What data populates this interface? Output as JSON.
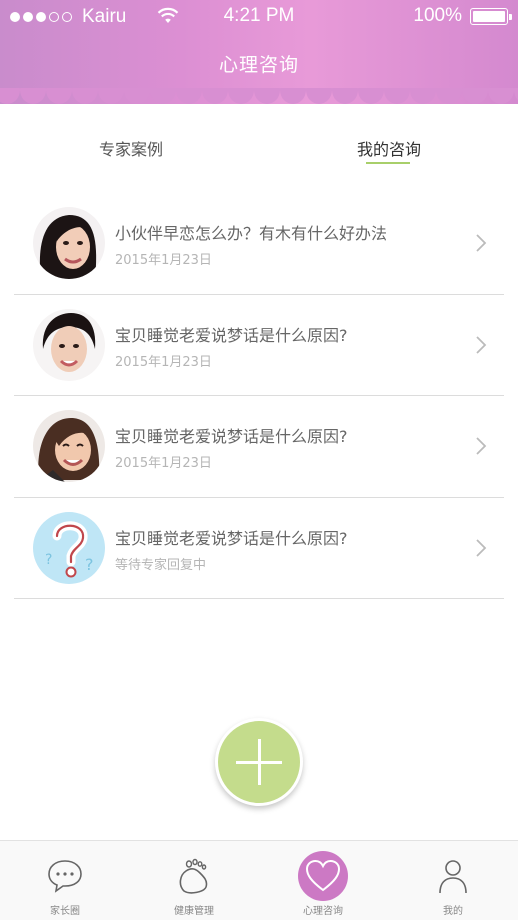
{
  "status_bar": {
    "carrier": "Kairu",
    "time": "4:21 PM",
    "battery": "100%"
  },
  "header": {
    "title": "心理咨询"
  },
  "tabs": [
    {
      "label": "专家案例",
      "active": false
    },
    {
      "label": "我的咨询",
      "active": true
    }
  ],
  "consultations": [
    {
      "title": "小伙伴早恋怎么办？有木有什么好办法",
      "subtitle": "2015年1月23日",
      "avatar": "woman-avatar-1"
    },
    {
      "title": "宝贝睡觉老爱说梦话是什么原因?",
      "subtitle": "2015年1月23日",
      "avatar": "woman-avatar-2"
    },
    {
      "title": "宝贝睡觉老爱说梦话是什么原因?",
      "subtitle": "2015年1月23日",
      "avatar": "woman-avatar-3"
    },
    {
      "title": "宝贝睡觉老爱说梦话是什么原因?",
      "subtitle": "等待专家回复中",
      "avatar": "question-mark-avatar"
    }
  ],
  "fab": {
    "icon": "plus-icon"
  },
  "bottom_nav": [
    {
      "label": "家长圈",
      "icon": "chat-bubble-icon",
      "active": false
    },
    {
      "label": "健康管理",
      "icon": "foot-icon",
      "active": false
    },
    {
      "label": "心理咨询",
      "icon": "heart-icon",
      "active": true
    },
    {
      "label": "我的",
      "icon": "person-icon",
      "active": false
    }
  ],
  "colors": {
    "header_gradient_start": "#c98ccc",
    "header_gradient_end": "#e89ad8",
    "accent_green": "#a8cf6a",
    "fab_green": "#c4dc8c",
    "nav_active": "#cc79c4"
  }
}
